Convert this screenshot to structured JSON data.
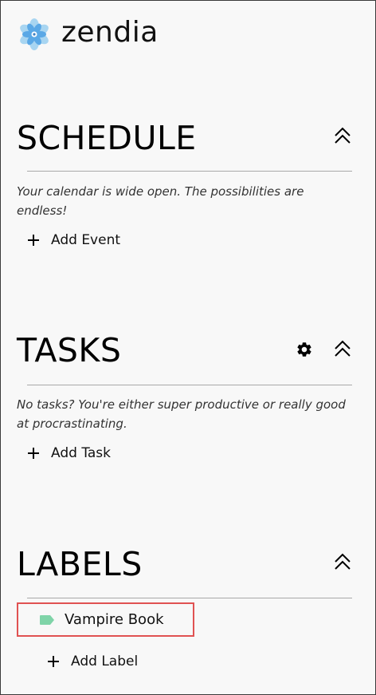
{
  "app": {
    "name": "zendia"
  },
  "sections": {
    "schedule": {
      "title": "SCHEDULE",
      "empty_message": "Your calendar is wide open. The possibilities are endless!",
      "add_label": "Add Event"
    },
    "tasks": {
      "title": "TASKS",
      "empty_message": "No tasks? You're either super productive or really good at procrastinating.",
      "add_label": "Add Task"
    },
    "labels": {
      "title": "LABELS",
      "items": [
        {
          "label": "Vampire Book",
          "color": "#7fd4a8"
        }
      ],
      "add_label": "Add Label"
    }
  },
  "icons": {
    "logo": "flower-logo-icon",
    "collapse": "double-chevron-up-icon",
    "settings": "gear-icon",
    "add": "plus-icon",
    "tag": "tag-icon"
  },
  "colors": {
    "background": "#f8f8f8",
    "highlight_border": "#e05252",
    "label_tag": "#7fd4a8",
    "logo_primary": "#5aa8e6",
    "logo_secondary": "#9fd0ef"
  }
}
